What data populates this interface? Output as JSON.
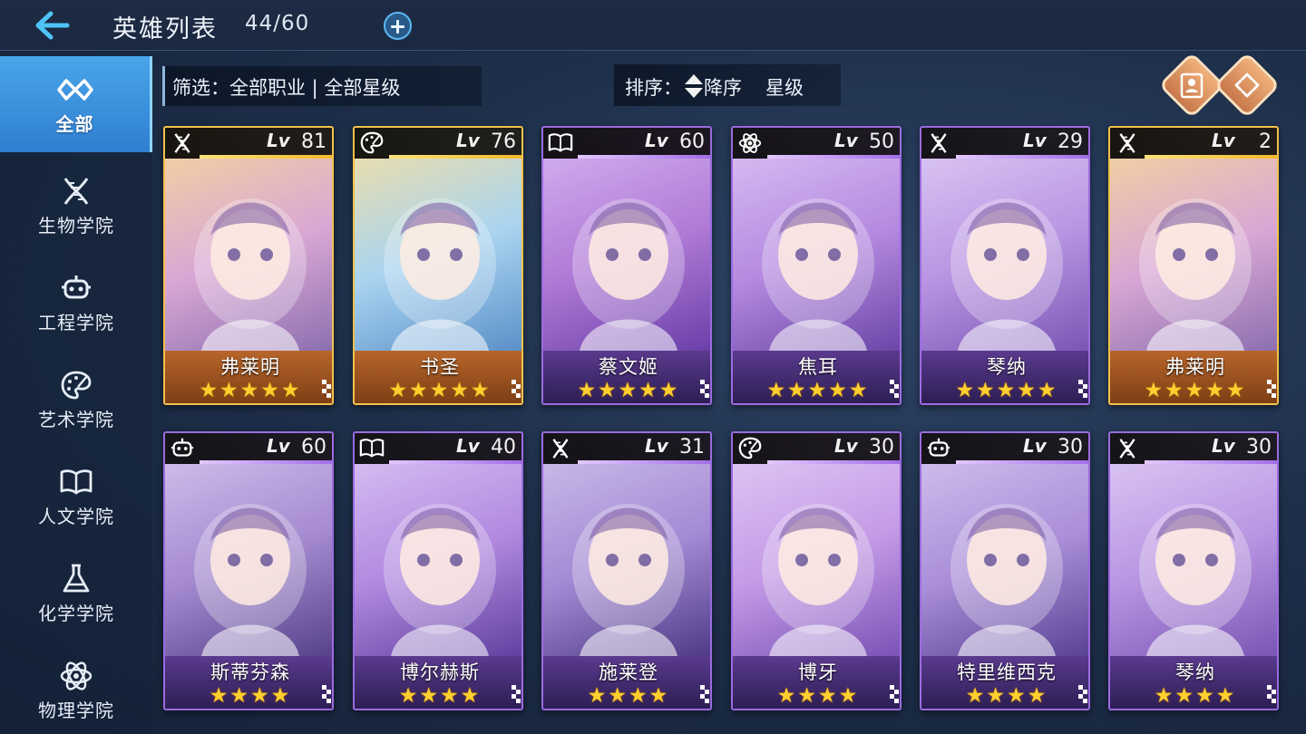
{
  "header": {
    "title": "英雄列表",
    "count": "44/60"
  },
  "sidebar": {
    "items": [
      {
        "label": "全部",
        "icon": "infinity-icon",
        "active": true
      },
      {
        "label": "生物学院",
        "icon": "dna-icon",
        "active": false
      },
      {
        "label": "工程学院",
        "icon": "robot-icon",
        "active": false
      },
      {
        "label": "艺术学院",
        "icon": "palette-icon",
        "active": false
      },
      {
        "label": "人文学院",
        "icon": "book-icon",
        "active": false
      },
      {
        "label": "化学学院",
        "icon": "flask-icon",
        "active": false
      },
      {
        "label": "物理学院",
        "icon": "atom-icon",
        "active": false
      }
    ]
  },
  "filter": {
    "text": "筛选：全部职业 | 全部星级"
  },
  "sort": {
    "prefix": "排序：",
    "order": "降序",
    "field": "星级"
  },
  "cards": [
    {
      "name": "弗莱明",
      "lv_label": "Lv",
      "level": "81",
      "stars": 5,
      "class_icon": "dna-icon",
      "rarity": "gold"
    },
    {
      "name": "书圣",
      "lv_label": "Lv",
      "level": "76",
      "stars": 5,
      "class_icon": "palette-icon",
      "rarity": "gold"
    },
    {
      "name": "蔡文姬",
      "lv_label": "Lv",
      "level": "60",
      "stars": 5,
      "class_icon": "book-icon",
      "rarity": "purple"
    },
    {
      "name": "焦耳",
      "lv_label": "Lv",
      "level": "50",
      "stars": 5,
      "class_icon": "atom-icon",
      "rarity": "purple"
    },
    {
      "name": "琴纳",
      "lv_label": "Lv",
      "level": "29",
      "stars": 5,
      "class_icon": "dna-icon",
      "rarity": "purple"
    },
    {
      "name": "弗莱明",
      "lv_label": "Lv",
      "level": "2",
      "stars": 5,
      "class_icon": "dna-icon",
      "rarity": "gold"
    },
    {
      "name": "斯蒂芬森",
      "lv_label": "Lv",
      "level": "60",
      "stars": 4,
      "class_icon": "robot-icon",
      "rarity": "purple"
    },
    {
      "name": "博尔赫斯",
      "lv_label": "Lv",
      "level": "40",
      "stars": 4,
      "class_icon": "book-icon",
      "rarity": "purple"
    },
    {
      "name": "施莱登",
      "lv_label": "Lv",
      "level": "31",
      "stars": 4,
      "class_icon": "dna-icon",
      "rarity": "purple"
    },
    {
      "name": "博牙",
      "lv_label": "Lv",
      "level": "30",
      "stars": 4,
      "class_icon": "palette-icon",
      "rarity": "purple"
    },
    {
      "name": "特里维西克",
      "lv_label": "Lv",
      "level": "30",
      "stars": 4,
      "class_icon": "robot-icon",
      "rarity": "purple"
    },
    {
      "name": "琴纳",
      "lv_label": "Lv",
      "level": "30",
      "stars": 4,
      "class_icon": "dna-icon",
      "rarity": "purple"
    }
  ],
  "colors": {
    "accent": "#3f95e0",
    "gold_frame": "#f2c14b",
    "purple_frame": "#9b6be0",
    "star": "#ffcf2f"
  }
}
